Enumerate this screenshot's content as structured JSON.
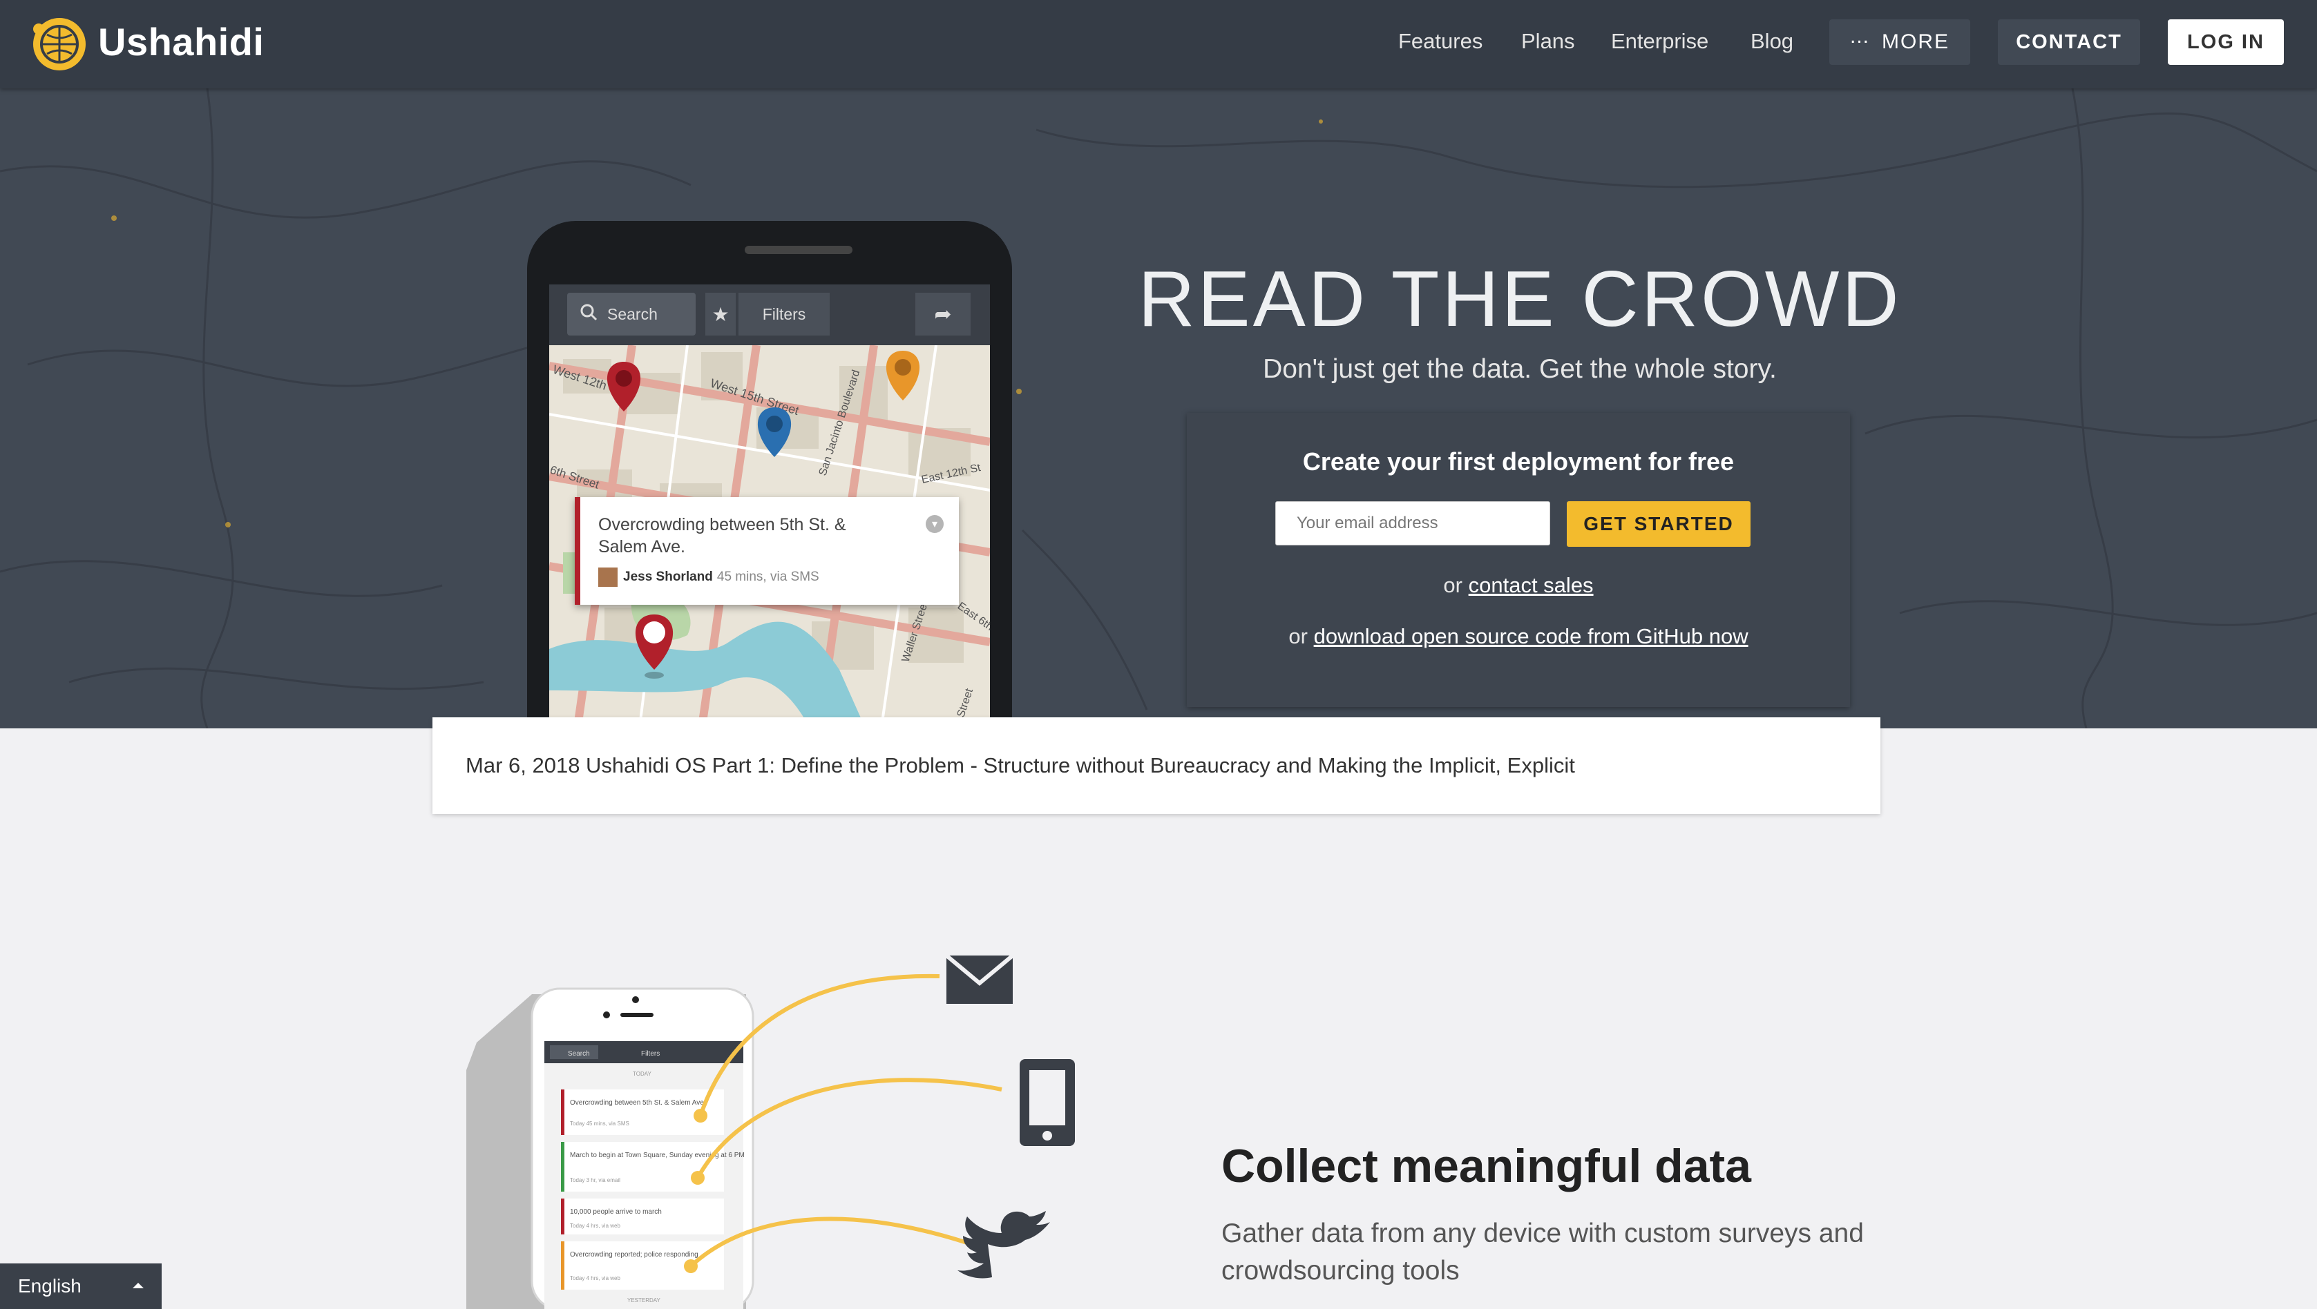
{
  "nav": {
    "brand": "Ushahidi",
    "links": [
      "Features",
      "Plans",
      "Enterprise",
      "Blog"
    ],
    "more_label": "MORE",
    "contact_label": "CONTACT",
    "login_label": "LOG IN"
  },
  "hero": {
    "title": "READ THE CROWD",
    "subtitle": "Don't just get the data. Get the whole story.",
    "signup": {
      "title": "Create your first deployment for free",
      "email_placeholder": "Your email address",
      "cta_label": "GET STARTED",
      "or_1": "or",
      "contact_sales_link": "contact sales",
      "or_2": "or",
      "github_link": "download open source code from GitHub now"
    },
    "phone": {
      "search_label": "Search",
      "filters_label": "Filters",
      "popup_title": "Overcrowding between 5th St. & Salem Ave.",
      "popup_user": "Jess Shorland",
      "popup_meta": "45 mins, via SMS",
      "streets": [
        "West 12th",
        "West 15th Street",
        "San Jacinto Boulevard",
        "East 12th St",
        "6th Street",
        "Waller Street",
        "East 6th",
        "Street"
      ]
    }
  },
  "news": {
    "text": "Mar 6, 2018 Ushahidi OS Part 1: Define the Problem - Structure without Bureaucracy and Making the Implicit, Explicit"
  },
  "collect": {
    "title": "Collect meaningful data",
    "description": "Gather data from any device with custom surveys and crowdsourcing tools",
    "mini_phone": {
      "search_label": "Search",
      "filters_label": "Filters",
      "today_label": "TODAY",
      "yesterday_label": "YESTERDAY",
      "items": [
        {
          "title": "Overcrowding between 5th St. & Salem Ave.",
          "meta": "Today 45 mins, via SMS"
        },
        {
          "title": "March to begin at Town Square, Sunday evening at 6 PM",
          "meta": "Today 3 hr, via email"
        },
        {
          "title": "10,000 people arrive to march",
          "meta": "Today 4 hrs, via web"
        },
        {
          "title": "Overcrowding reported; police responding",
          "meta": "Today 4 hrs, via web"
        }
      ]
    }
  },
  "language": {
    "current": "English"
  },
  "colors": {
    "nav_bg": "#353c46",
    "hero_bg": "#414954",
    "accent_yellow": "#f3bb2d",
    "marker_red": "#b1202b",
    "marker_blue": "#2a6fb0",
    "marker_orange": "#e8962a"
  }
}
